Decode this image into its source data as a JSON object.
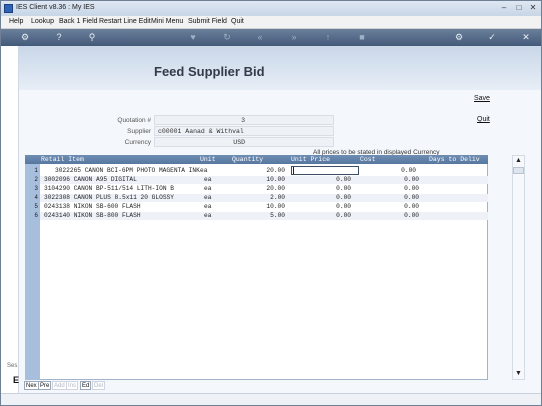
{
  "window": {
    "title": "IES Client v8.36 : My IES"
  },
  "menu": {
    "items": [
      "Help",
      "Lookup",
      "Back 1 Field",
      "Restart Line Edit",
      "Mini Menu",
      "Submit Field",
      "Quit"
    ]
  },
  "toolbar": {
    "icons": [
      "key-icon",
      "help-icon",
      "search-icon",
      "heart-icon",
      "refresh-icon",
      "rewind-icon",
      "fast-forward-icon",
      "upload-icon",
      "stop-icon",
      "settings-icon",
      "check-icon",
      "close-icon"
    ]
  },
  "page": {
    "title": "Feed Supplier Bid"
  },
  "actions": {
    "save": "Save",
    "quit": "Quit"
  },
  "form": {
    "quotation_label": "Quotation #",
    "quotation_value": "3",
    "supplier_label": "Supplier",
    "supplier_value": "c00001 Aanad & Withval",
    "currency_label": "Currency",
    "currency_value": "USD"
  },
  "note": "All prices to be stated in displayed Currency",
  "grid": {
    "columns": [
      "Retail Item",
      "Unit",
      "Quantity",
      "Unit Price",
      "Cost",
      "Days to Deliv"
    ],
    "rows": [
      {
        "n": "1",
        "item": "3022265 CANON BCI-6PM PHOTO MAGENTA INK",
        "unit": "ea",
        "qty": "20.00",
        "price": "",
        "cost": "0.00"
      },
      {
        "n": "2",
        "item": "3002096 CANON A95 DIGITAL",
        "unit": "ea",
        "qty": "10.00",
        "price": "0.00",
        "cost": "0.00"
      },
      {
        "n": "3",
        "item": "3104290 CANON BP-511/514 LITH-ION B",
        "unit": "ea",
        "qty": "20.00",
        "price": "0.00",
        "cost": "0.00"
      },
      {
        "n": "4",
        "item": "3022308 CANON PLUS 8.5x11 20 GLOSSY",
        "unit": "ea",
        "qty": "2.00",
        "price": "0.00",
        "cost": "0.00"
      },
      {
        "n": "5",
        "item": "0243138 NIKON SB-600 FLASH",
        "unit": "ea",
        "qty": "10.00",
        "price": "0.00",
        "cost": "0.00"
      },
      {
        "n": "6",
        "item": "0243140 NIKON SB-800 FLASH",
        "unit": "ea",
        "qty": "5.00",
        "price": "0.00",
        "cost": "0.00"
      }
    ]
  },
  "bottom_tabs": [
    {
      "label": "Nex",
      "enabled": true
    },
    {
      "label": "Pre",
      "enabled": true
    },
    {
      "label": "Add",
      "enabled": false
    },
    {
      "label": "Ins",
      "enabled": false
    },
    {
      "label": "Ed",
      "enabled": true
    },
    {
      "label": "Del",
      "enabled": false
    }
  ],
  "side": {
    "text": "Ses",
    "box": "E"
  }
}
